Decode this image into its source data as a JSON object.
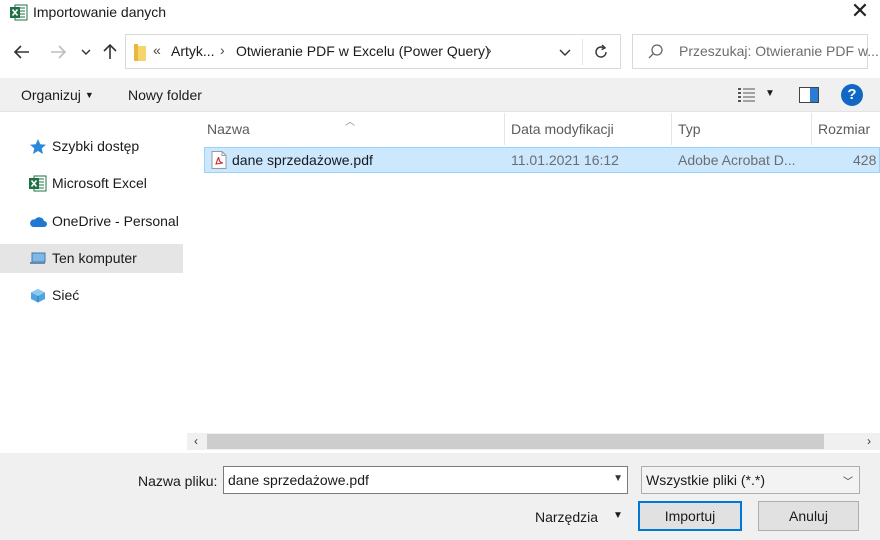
{
  "window": {
    "title": "Importowanie danych",
    "close_glyph": "✕",
    "app_icon": "excel-icon"
  },
  "nav": {
    "back_icon": "back-arrow-icon",
    "forward_icon": "forward-arrow-icon",
    "recent_icon": "chevron-down-icon",
    "up_icon": "up-arrow-icon"
  },
  "address": {
    "overflow": "«",
    "segments": [
      "Artyk...",
      "Otwieranie PDF w Excelu (Power Query)"
    ],
    "separator": "›"
  },
  "search": {
    "placeholder": "Przeszukaj: Otwieranie PDF w..."
  },
  "toolbar": {
    "organize_label": "Organizuj",
    "new_folder_label": "Nowy folder",
    "help_glyph": "?"
  },
  "sidebar": {
    "items": [
      {
        "label": "Szybki dostęp",
        "icon": "star-icon",
        "selected": false
      },
      {
        "label": "Microsoft Excel",
        "icon": "excel-icon",
        "selected": false
      },
      {
        "label": "OneDrive - Personal",
        "icon": "cloud-icon",
        "selected": false
      },
      {
        "label": "Ten komputer",
        "icon": "computer-icon",
        "selected": true
      },
      {
        "label": "Sieć",
        "icon": "network-icon",
        "selected": false
      }
    ]
  },
  "files": {
    "columns": [
      "Nazwa",
      "Data modyfikacji",
      "Typ",
      "Rozmiar"
    ],
    "rows": [
      {
        "name": "dane sprzedażowe.pdf",
        "modified": "11.01.2021 16:12",
        "type": "Adobe Acrobat D...",
        "size": "428",
        "icon": "pdf-file-icon",
        "selected": true
      }
    ]
  },
  "scrollbar": {
    "left_glyph": "‹",
    "right_glyph": "›"
  },
  "footer": {
    "filename_label": "Nazwa pliku:",
    "filename_value": "dane sprzedażowe.pdf",
    "filter_value": "Wszystkie pliki (*.*)",
    "tools_label": "Narzędzia",
    "import_label": "Importuj",
    "cancel_label": "Anuluj"
  },
  "colors": {
    "accent": "#0078d7",
    "selection": "#cce8ff",
    "selection_border": "#99d1ff",
    "excel_green": "#1e7145",
    "help_blue": "#1168c4"
  }
}
